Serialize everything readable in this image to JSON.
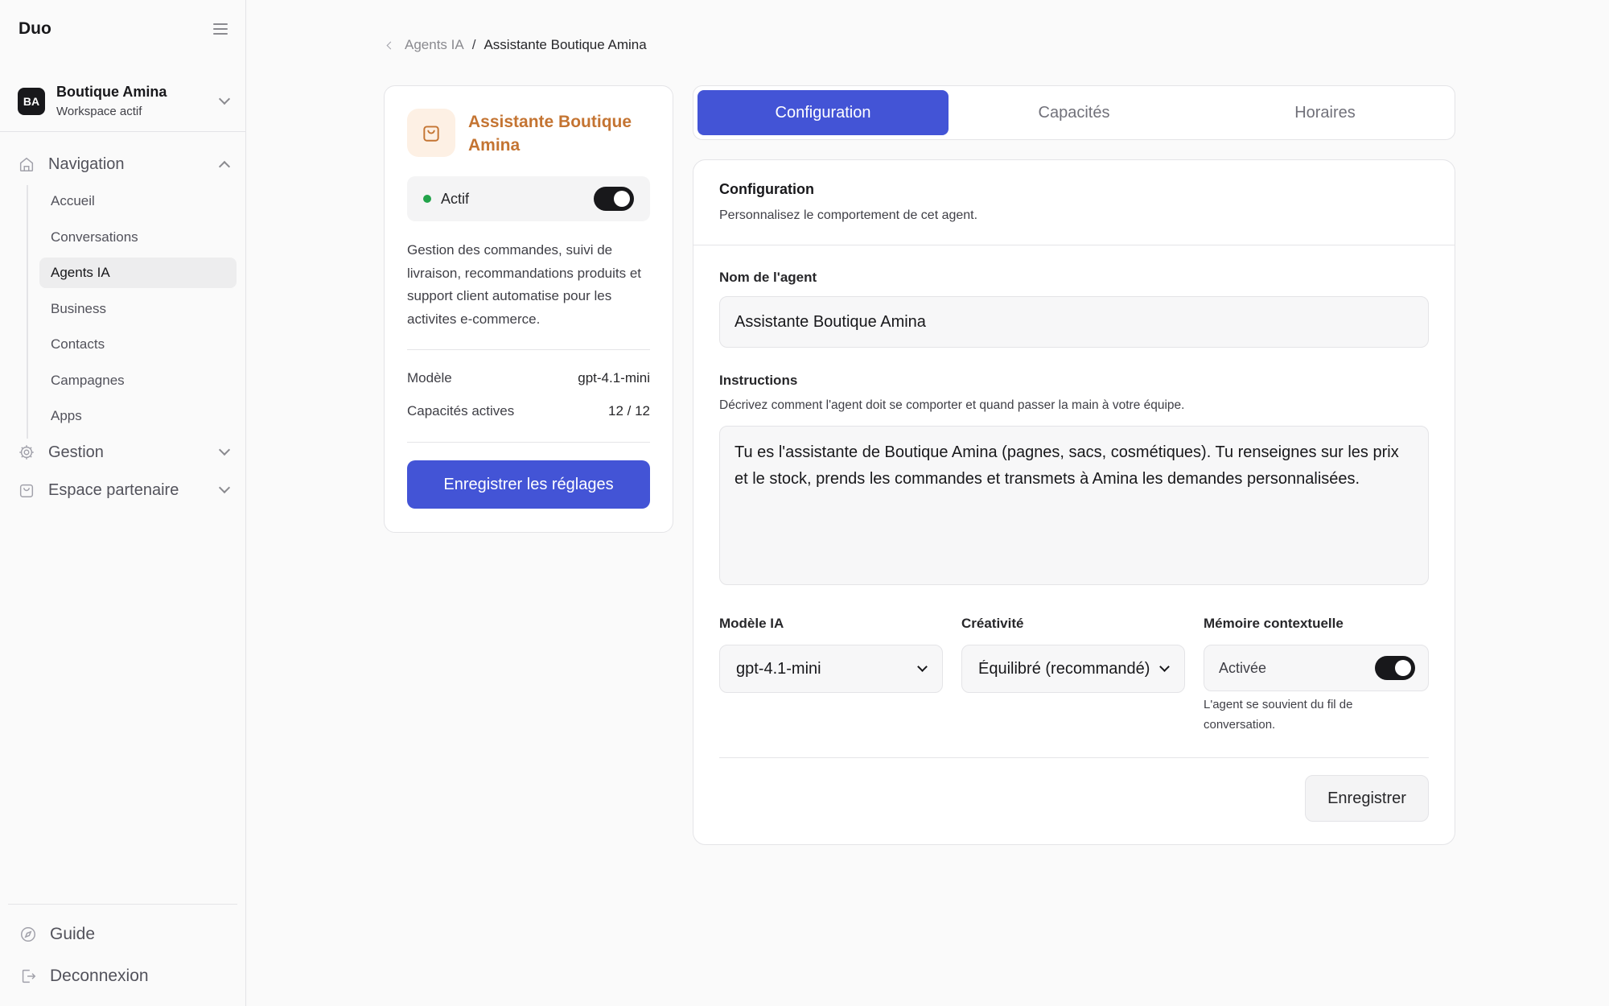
{
  "app": {
    "brand": "Duo"
  },
  "workspace": {
    "initials": "BA",
    "name": "Boutique Amina",
    "status": "Workspace actif"
  },
  "nav": {
    "navigation_label": "Navigation",
    "items": [
      {
        "label": "Accueil"
      },
      {
        "label": "Conversations"
      },
      {
        "label": "Agents IA"
      },
      {
        "label": "Business"
      },
      {
        "label": "Contacts"
      },
      {
        "label": "Campagnes"
      },
      {
        "label": "Apps"
      }
    ],
    "gestion_label": "Gestion",
    "partner_label": "Espace partenaire",
    "guide_label": "Guide",
    "logout_label": "Deconnexion"
  },
  "breadcrumb": {
    "parent": "Agents IA",
    "separator": "/",
    "current": "Assistante Boutique Amina"
  },
  "agent": {
    "title": "Assistante Boutique Amina",
    "status_label": "Actif",
    "active": true,
    "description": "Gestion des commandes, suivi de livraison, recommandations produits et support client automatise pour les activites e-commerce.",
    "model_label": "Modèle",
    "model_value": "gpt-4.1-mini",
    "capabilities_label": "Capacités actives",
    "capabilities_value": "12 / 12",
    "save_settings_label": "Enregistrer les réglages"
  },
  "tabs": [
    {
      "label": "Configuration",
      "active": true
    },
    {
      "label": "Capacités",
      "active": false
    },
    {
      "label": "Horaires",
      "active": false
    }
  ],
  "config": {
    "title": "Configuration",
    "subtitle": "Personnalisez le comportement de cet agent.",
    "name_label": "Nom de l'agent",
    "name_value": "Assistante Boutique Amina",
    "instructions_label": "Instructions",
    "instructions_hint": "Décrivez comment l'agent doit se comporter et quand passer la main à votre équipe.",
    "instructions_value": "Tu es l'assistante de Boutique Amina (pagnes, sacs, cosmétiques). Tu renseignes sur les prix et le stock, prends les commandes et transmets à Amina les demandes personnalisées.",
    "model_label": "Modèle IA",
    "model_value": "gpt-4.1-mini",
    "creativity_label": "Créativité",
    "creativity_value": "Équilibré (recommandé)",
    "memory_label": "Mémoire contextuelle",
    "memory_value": "Activée",
    "memory_enabled": true,
    "memory_hint": "L'agent se souvient du fil de conversation.",
    "save_label": "Enregistrer"
  },
  "colors": {
    "accent": "#4354d6",
    "agent_title": "#c47432",
    "status_active": "#22a34a"
  }
}
